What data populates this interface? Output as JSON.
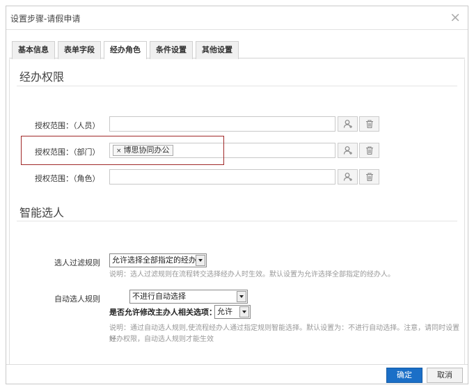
{
  "dialog": {
    "title": "设置步骤-请假申请",
    "close_glyph": "×"
  },
  "tabs": [
    {
      "label": "基本信息",
      "active": false
    },
    {
      "label": "表单字段",
      "active": false
    },
    {
      "label": "经办角色",
      "active": true
    },
    {
      "label": "条件设置",
      "active": false
    },
    {
      "label": "其他设置",
      "active": false
    }
  ],
  "permissions": {
    "title": "经办权限",
    "rows": [
      {
        "label": "授权范围：（人员）",
        "value": "",
        "tags": []
      },
      {
        "label": "授权范围：（部门）",
        "value": "",
        "tags": [
          "博思协同办公"
        ]
      },
      {
        "label": "授权范围：（角色）",
        "value": "",
        "tags": []
      }
    ],
    "tag_remove_glyph": "×",
    "icons": {
      "add": "add-user-icon",
      "delete": "trash-icon"
    }
  },
  "smart": {
    "title": "智能选人",
    "filter_rule": {
      "label": "选人过滤规则",
      "selected": "允许选择全部指定的经办人",
      "hint": "说明：选人过滤规则在流程转交选择经办人时生效。默认设置为允许选择全部指定的经办人。"
    },
    "auto_rule": {
      "label": "自动选人规则",
      "selected": "不进行自动选择",
      "allow_label": "是否允许修改主办人相关选项：",
      "allow_selected": "允许",
      "hint_line1": "说明：通过自动选人规则,使流程经办人通过指定规则智能选择。默认设置为：不进行自动选择。注意，请同时设置好",
      "hint_line2": "经办权限，自动选人规则才能生效"
    }
  },
  "footer": {
    "confirm_label": "确定",
    "cancel_label": "取消"
  }
}
